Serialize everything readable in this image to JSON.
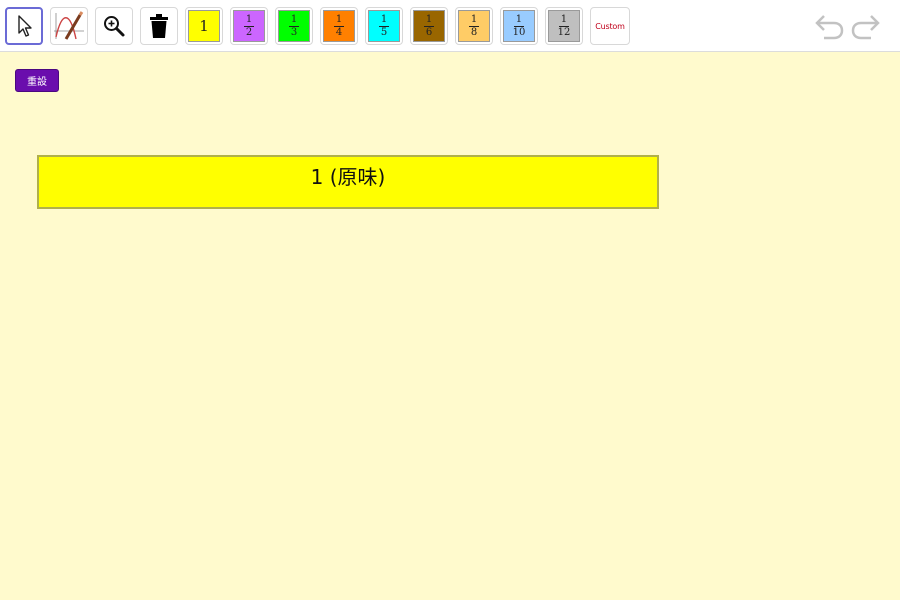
{
  "toolbar": {
    "tools": [
      {
        "name": "move-tool",
        "icon": "arrow-pointer-icon",
        "selected": true
      },
      {
        "name": "pen-tool",
        "icon": "function-pen-icon"
      },
      {
        "name": "zoom-tool",
        "icon": "zoom-in-icon"
      },
      {
        "name": "delete-tool",
        "icon": "trash-icon"
      }
    ],
    "fraction_bars": [
      {
        "label": "1",
        "color": "#ffff00"
      },
      {
        "numerator": "1",
        "denominator": "2",
        "color": "#cc66ff"
      },
      {
        "numerator": "1",
        "denominator": "3",
        "color": "#00ff00"
      },
      {
        "numerator": "1",
        "denominator": "4",
        "color": "#ff8000"
      },
      {
        "numerator": "1",
        "denominator": "5",
        "color": "#00ffff"
      },
      {
        "numerator": "1",
        "denominator": "6",
        "color": "#996600"
      },
      {
        "numerator": "1",
        "denominator": "8",
        "color": "#ffcc66"
      },
      {
        "numerator": "1",
        "denominator": "10",
        "color": "#99ccff"
      },
      {
        "numerator": "1",
        "denominator": "12",
        "color": "#bfbfbf"
      }
    ],
    "custom_label": "Custom",
    "undo_icon": "undo-icon",
    "redo_icon": "redo-icon"
  },
  "reset_button": {
    "label": "重設",
    "color": "#6a0dad"
  },
  "canvas": {
    "bar_label": "1 (原味)",
    "bar_color": "#ffff00"
  }
}
